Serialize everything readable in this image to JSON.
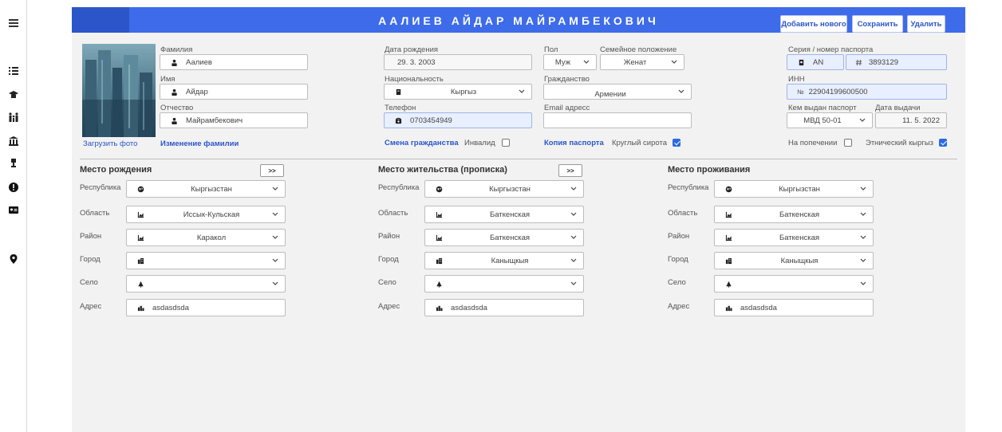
{
  "rail": {
    "icons": [
      "menu-icon",
      "list-icon",
      "graduation-cap-icon",
      "family-icon",
      "bank-icon",
      "award-icon",
      "alert-icon",
      "id-card-icon",
      "location-pin-icon"
    ]
  },
  "header": {
    "title": "ААЛИЕВ АЙДАР МАЙРАМБЕКОВИЧ",
    "add_label": "Добавить нового",
    "save_label": "Сохранить",
    "delete_label": "Удалить"
  },
  "photo": {
    "upload_label": "Загрузить фото"
  },
  "person": {
    "surname_label": "Фамилия",
    "surname": "Аалиев",
    "name_label": "Имя",
    "name": "Айдар",
    "patronymic_label": "Отчество",
    "patronymic": "Майрамбекович",
    "change_surname_link": "Изменение фамилии",
    "birthdate_label": "Дата рождения",
    "birthdate": "29. 3. 2003",
    "nationality_label": "Национальность",
    "nationality": "Кыргыз",
    "phone_label": "Телефон",
    "phone": "0703454949",
    "change_citizenship_link": "Смена гражданства",
    "disabled_label": "Инвалид",
    "disabled_checked": false,
    "gender_label": "Пол",
    "gender": "Муж",
    "marital_label": "Семейное положение",
    "marital": "Женат",
    "citizenship_label": "Гражданство",
    "citizenship": "Армении",
    "email_label": "Email адресс",
    "email": "",
    "passport_copy_link": "Копия паспорта",
    "orphan_label": "Круглый сирота",
    "orphan_checked": true,
    "passport_label": "Серия / номер паспорта",
    "passport_series": "AN",
    "passport_number": "3893129",
    "inn_label": "ИНН",
    "inn_prefix": "№",
    "inn": "22904199600500",
    "issued_by_label": "Кем выдан паспорт",
    "issued_by": "МВД 50-01",
    "issue_date_label": "Дата выдачи",
    "issue_date": "11. 5. 2022",
    "guardianship_label": "На попечении",
    "guardianship_checked": false,
    "ethnic_label": "Этнический кыргыз",
    "ethnic_checked": true
  },
  "address_labels": {
    "republic": "Республика",
    "region": "Область",
    "district": "Район",
    "city": "Город",
    "village": "Село",
    "address": "Адрес",
    "copy_button": ">>"
  },
  "sections": [
    {
      "title": "Место рождения",
      "republic": "Кыргызстан",
      "region": "Иссык-Кульская",
      "district": "Каракол",
      "city": "",
      "village": "",
      "address": "asdasdsda"
    },
    {
      "title": "Место жительства (прописка)",
      "republic": "Кыргызстан",
      "region": "Баткенская",
      "district": "Баткенская",
      "city": "Каныщкыя",
      "village": "",
      "address": "asdasdsda"
    },
    {
      "title": "Место проживания",
      "republic": "Кыргызстан",
      "region": "Баткенская",
      "district": "Баткенская",
      "city": "Каныщкыя",
      "village": "",
      "address": "asdasdsda"
    }
  ],
  "colors": {
    "accent": "#3d6bea",
    "accent_dark": "#2b55c9",
    "panel": "#f2f2f2",
    "field_highlight": "#e8efff"
  }
}
